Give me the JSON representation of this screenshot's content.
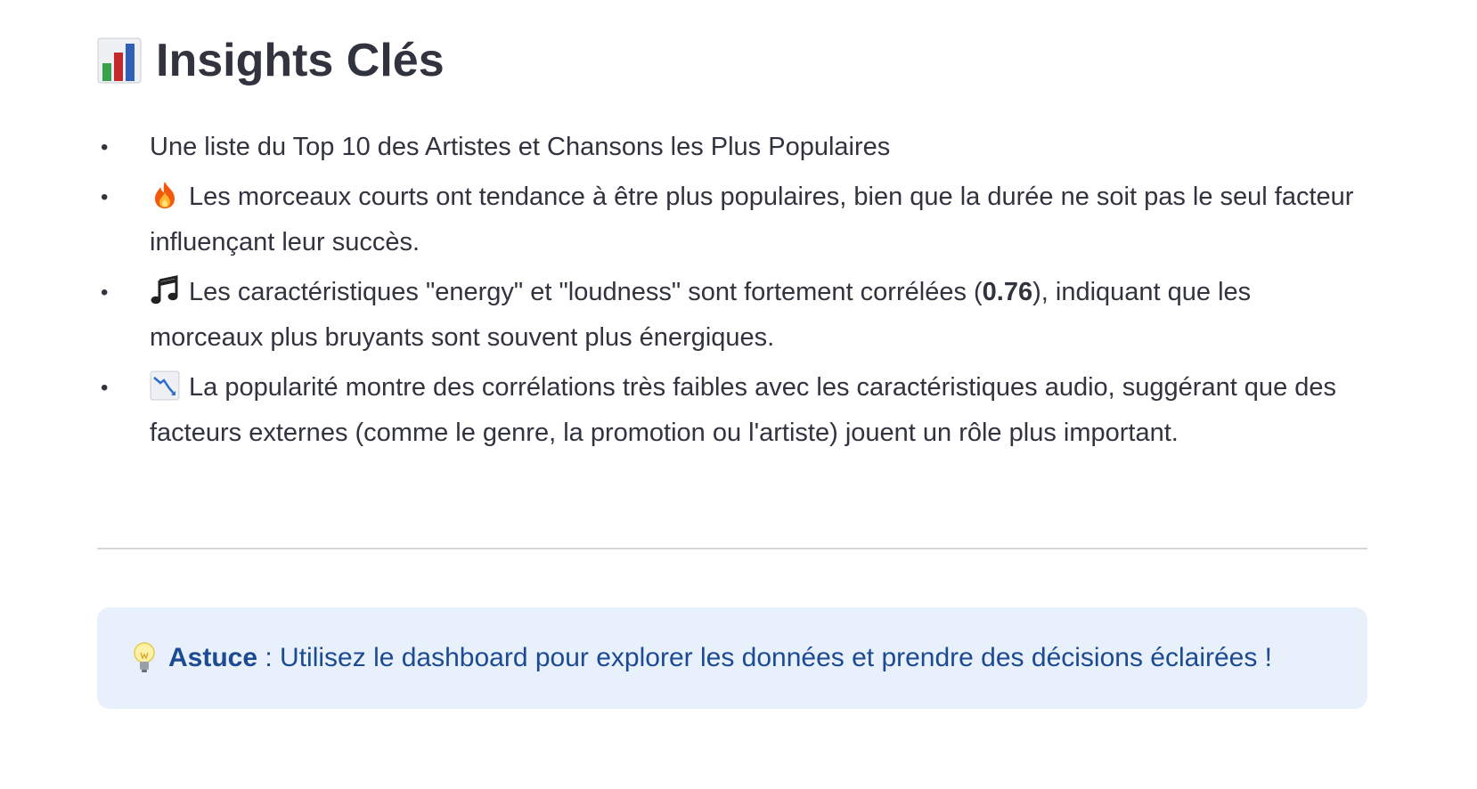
{
  "heading": {
    "icon": "bar-chart-icon",
    "title": "Insights Clés"
  },
  "insights": [
    {
      "icon": "",
      "text_before": "Une liste du Top 10 des Artistes et Chansons les Plus Populaires",
      "bold": "",
      "text_after": ""
    },
    {
      "icon": "fire-icon",
      "text_before": "Les morceaux courts ont tendance à être plus populaires, bien que la durée ne soit pas le seul facteur influençant leur succès.",
      "bold": "",
      "text_after": ""
    },
    {
      "icon": "music-notes-icon",
      "text_before": "Les caractéristiques \"energy\" et \"loudness\" sont fortement corrélées (",
      "bold": "0.76",
      "text_after": "), indiquant que les morceaux plus bruyants sont souvent plus énergiques."
    },
    {
      "icon": "chart-decreasing-icon",
      "text_before": "La popularité montre des corrélations très faibles avec les caractéristiques audio, suggérant que des facteurs externes (comme le genre, la promotion ou l'artiste) jouent un rôle plus important.",
      "bold": "",
      "text_after": ""
    }
  ],
  "callout": {
    "icon": "light-bulb-icon",
    "label": "Astuce",
    "text": " : Utilisez le dashboard pour explorer les données et prendre des décisions éclairées !"
  },
  "colors": {
    "text": "#31333f",
    "callout_bg": "#e8f0fb",
    "callout_text": "#1c4a93",
    "divider": "#d6d6d9"
  }
}
